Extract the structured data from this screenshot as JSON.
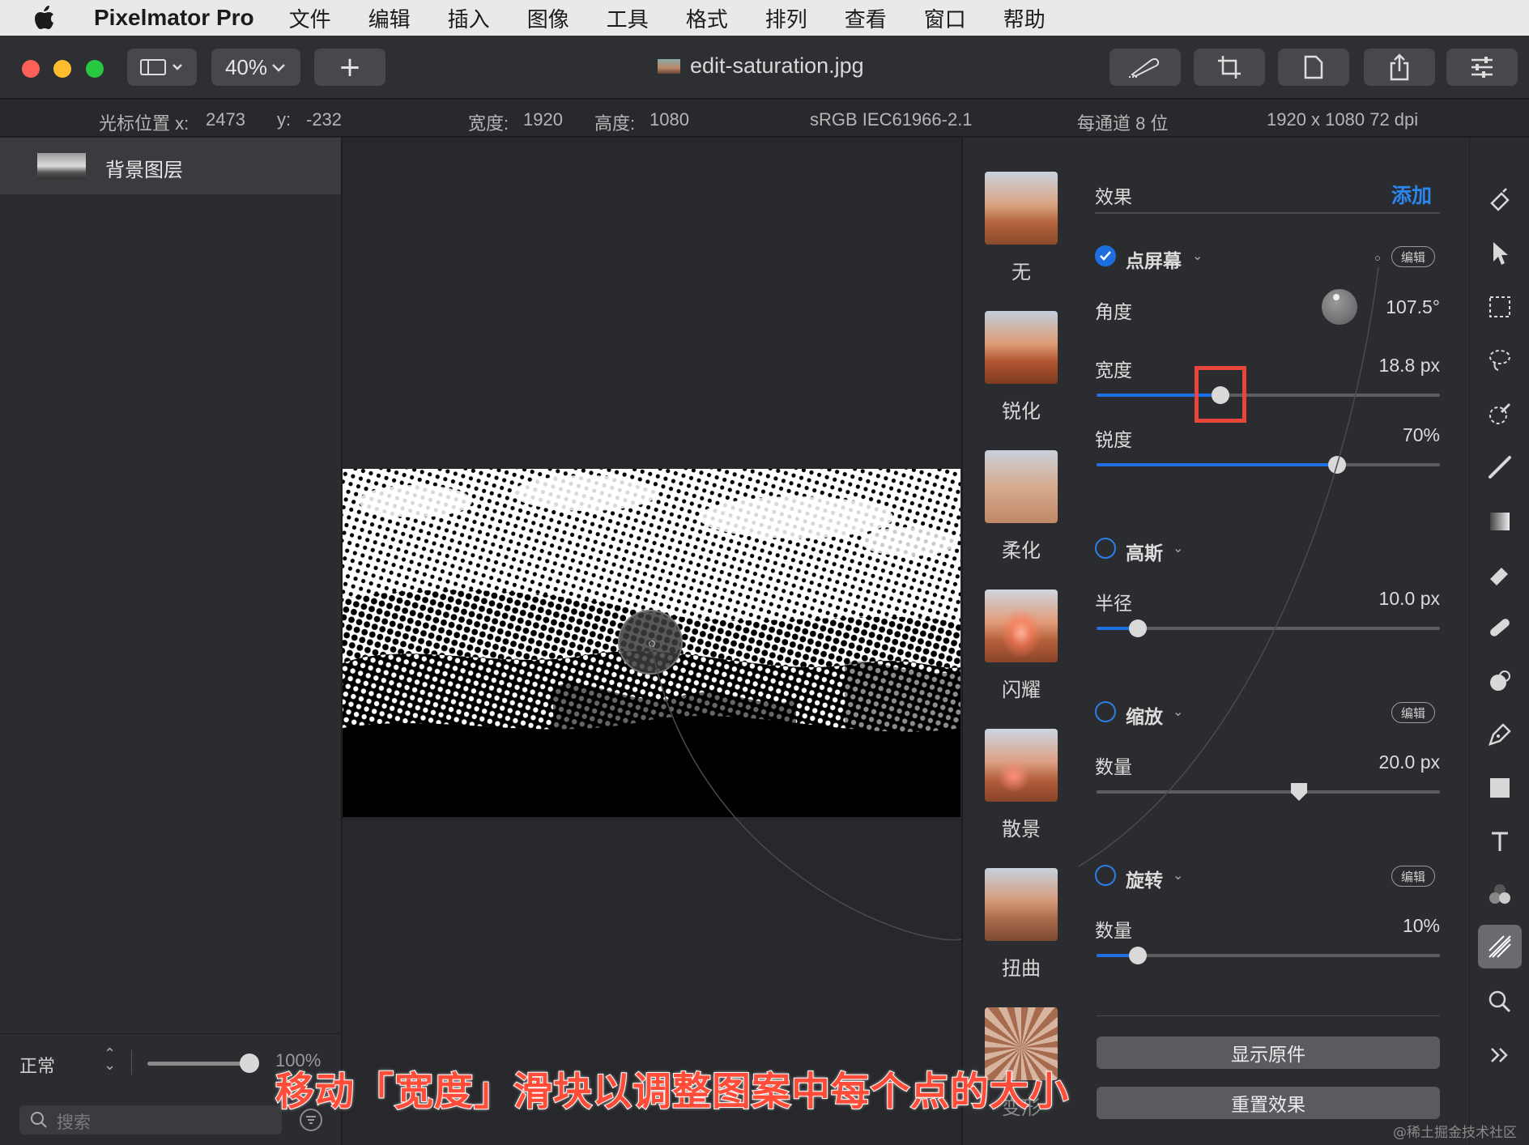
{
  "menubar": {
    "app_name": "Pixelmator Pro",
    "items": [
      "文件",
      "编辑",
      "插入",
      "图像",
      "工具",
      "格式",
      "排列",
      "查看",
      "窗口",
      "帮助"
    ]
  },
  "toolbar": {
    "zoom": "40%",
    "add_symbol": "+",
    "document_title": "edit-saturation.jpg"
  },
  "infobar": {
    "cursor_label": "光标位置 x:",
    "cursor_x": "2473",
    "cursor_y_label": "y:",
    "cursor_y": "-232",
    "width_label": "宽度:",
    "width": "1920",
    "height_label": "高度:",
    "height": "1080",
    "color_profile": "sRGB IEC61966-2.1",
    "bit_depth": "每通道 8 位",
    "size_dpi": "1920 x 1080 72 dpi"
  },
  "layers": {
    "items": [
      {
        "name": "背景图层"
      }
    ],
    "blend_mode": "正常",
    "opacity": "100%",
    "search_placeholder": "搜索"
  },
  "effects_browser": {
    "items": [
      "无",
      "锐化",
      "柔化",
      "闪耀",
      "散景",
      "扭曲",
      "变形"
    ]
  },
  "settings": {
    "header": "效果",
    "add_label": "添加",
    "edit_label": "编辑",
    "effects": [
      {
        "name": "点屏幕",
        "enabled": true,
        "params": [
          {
            "label": "角度",
            "value": "107.5°"
          },
          {
            "label": "宽度",
            "value": "18.8 px",
            "fraction": 0.36
          },
          {
            "label": "锐度",
            "value": "70%",
            "fraction": 0.7
          }
        ]
      },
      {
        "name": "高斯",
        "enabled": false,
        "params": [
          {
            "label": "半径",
            "value": "10.0 px",
            "fraction": 0.12
          }
        ]
      },
      {
        "name": "缩放",
        "enabled": false,
        "params": [
          {
            "label": "数量",
            "value": "20.0 px",
            "fraction": 0.59
          }
        ]
      },
      {
        "name": "旋转",
        "enabled": false,
        "params": [
          {
            "label": "数量",
            "value": "10%",
            "fraction": 0.12
          }
        ]
      }
    ],
    "show_original": "显示原件",
    "reset_effects": "重置效果"
  },
  "caption": "移动「宽度」滑块以调整图案中每个点的大小",
  "watermark": "@稀土掘金技术社区",
  "colors": {
    "accent_blue": "#1f6fe5",
    "highlight_red": "#e8453c",
    "traffic_red": "#fe5f57",
    "traffic_yellow": "#febc2e",
    "traffic_green": "#28c840"
  },
  "tools": [
    "paint-bucket-icon",
    "arrow-icon",
    "rect-select-icon",
    "lasso-icon",
    "color-picker-icon",
    "brush-icon",
    "gradient-icon",
    "eraser-icon",
    "bandage-icon",
    "clone-icon",
    "pen-icon",
    "shape-icon",
    "text-icon",
    "color-adjust-icon",
    "effects-icon",
    "zoom-icon",
    "more-icon"
  ]
}
